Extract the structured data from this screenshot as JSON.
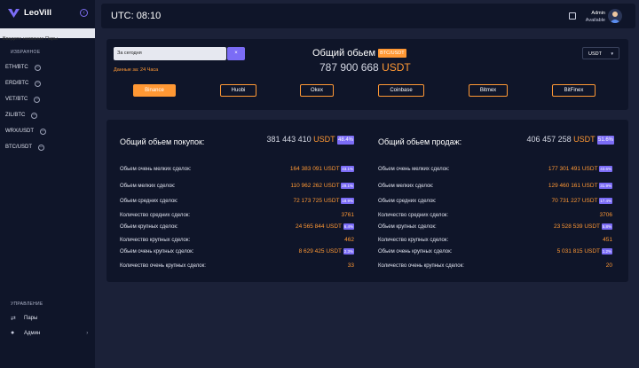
{
  "sidebar": {
    "logo_text": "LeoVill",
    "search_placeholder": "Введите название Пары",
    "favorites_title": "ИЗБРАННОЕ",
    "pairs": [
      "ETH/BTC",
      "ERD/BTC",
      "VET/BTC",
      "ZIL/BTC",
      "WRX/USDT",
      "BTC/USDT"
    ],
    "management_title": "УПРАВЛЕНИЕ",
    "menu": [
      {
        "label": "Пары",
        "icon": "swap-icon"
      },
      {
        "label": "Админ",
        "icon": "user-icon"
      }
    ]
  },
  "topbar": {
    "utc": "UTC: 08:10",
    "admin_name": "Admin",
    "admin_status": "Available"
  },
  "volume": {
    "period_select": "За сегодня",
    "clear_label": "×",
    "period_note": "Данные за: 24 Часа",
    "title": "Общий обьем",
    "pair_badge": "BTC/USDT",
    "amount": "787 900 668",
    "unit": "USDT",
    "currency": "USDT",
    "exchanges": [
      "Binance",
      "Huobi",
      "Okex",
      "Coinbase",
      "Bitmex",
      "BitFinex"
    ],
    "active_exchange": "Binance"
  },
  "buy": {
    "title": "Общий обьем покупок:",
    "total": "381 443 410",
    "unit": "USDT",
    "pct": "48.4%",
    "rows": [
      {
        "label": "Обьем очень мелких сделок:",
        "value": "164 383 091 USDT",
        "pct": "43.1%"
      },
      {
        "label": "Обьем мелких сделок:",
        "value": "110 962 262 USDT",
        "pct": "29.1%"
      },
      {
        "label": "Обьем средних сделок:",
        "value": "72 173 725 USDT",
        "pct": "18.9%"
      },
      {
        "label": "Количество средних сделок:",
        "value": "3761"
      },
      {
        "label": "Обьем крупных сделок:",
        "value": "24 565 844 USDT",
        "pct": "6.4%"
      },
      {
        "label": "Количество крупных сделок:",
        "value": "462"
      },
      {
        "label": "Обьем очень крупных сделок:",
        "value": "8 629 425 USDT",
        "pct": "2.3%"
      },
      {
        "label": "Количество очень крупных сделок:",
        "value": "33"
      }
    ]
  },
  "sell": {
    "title": "Общий обьем продаж:",
    "total": "406 457 258",
    "unit": "USDT",
    "pct": "51.6%",
    "rows": [
      {
        "label": "Обьем очень мелких сделок:",
        "value": "177 301 491 USDT",
        "pct": "43.6%"
      },
      {
        "label": "Обьем мелких сделок:",
        "value": "129 460 161 USDT",
        "pct": "31.9%"
      },
      {
        "label": "Обьем средних сделок:",
        "value": "70 731 227 USDT",
        "pct": "17.4%"
      },
      {
        "label": "Количество средних сделок:",
        "value": "3706"
      },
      {
        "label": "Обьем крупных сделок:",
        "value": "23 528 539 USDT",
        "pct": "5.8%"
      },
      {
        "label": "Количество крупных сделок:",
        "value": "451"
      },
      {
        "label": "Обьем очень крупных сделок:",
        "value": "5 031 815 USDT",
        "pct": "1.2%"
      },
      {
        "label": "Количество очень крупных сделок:",
        "value": "20"
      }
    ]
  },
  "colors": {
    "accent": "#ff9834",
    "purple": "#7b6cf6",
    "bg": "#1b2138",
    "panel": "#0f1529"
  }
}
